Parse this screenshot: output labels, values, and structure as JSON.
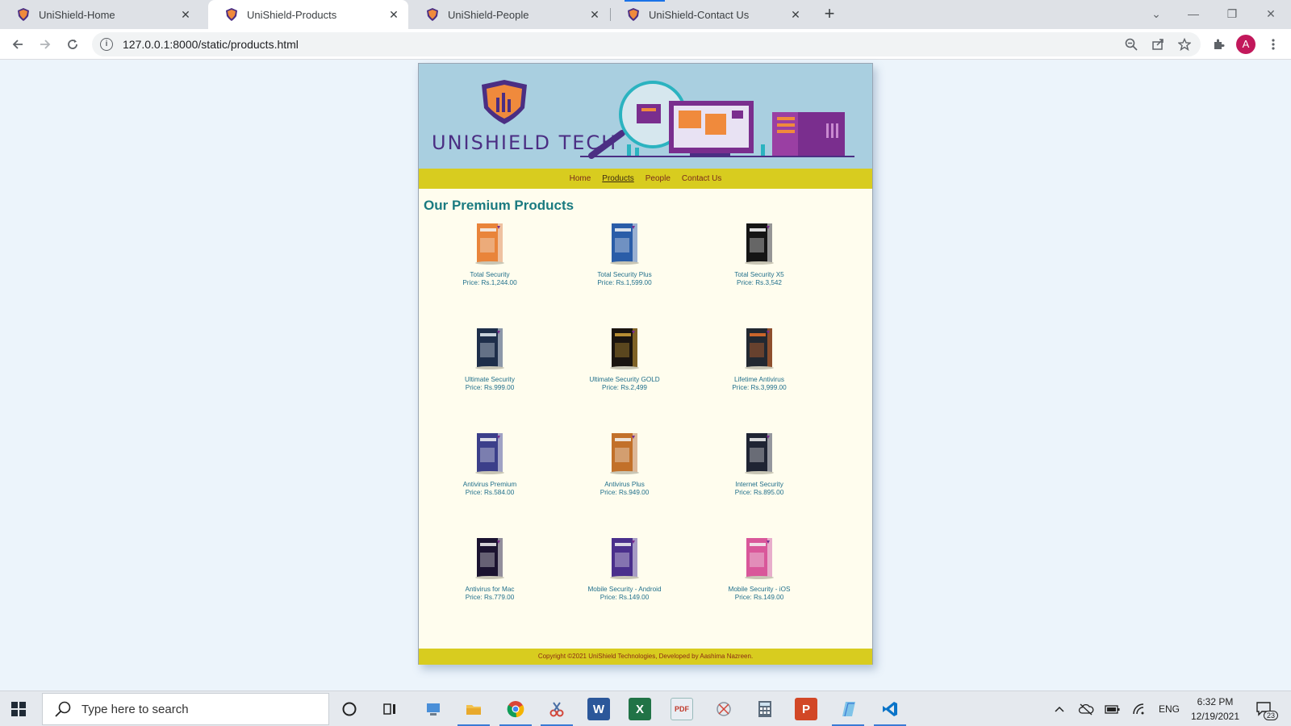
{
  "browser": {
    "tabs": [
      {
        "title": "UniShield-Home",
        "active": false
      },
      {
        "title": "UniShield-Products",
        "active": true
      },
      {
        "title": "UniShield-People",
        "active": false
      },
      {
        "title": "UniShield-Contact Us",
        "active": false
      }
    ],
    "new_tab_label": "+",
    "url": "127.0.0.1:8000/static/products.html",
    "profile_initial": "A"
  },
  "site": {
    "brand": "UNISHIELD TECH",
    "nav": [
      {
        "label": "Home",
        "current": false
      },
      {
        "label": "Products",
        "current": true
      },
      {
        "label": "People",
        "current": false
      },
      {
        "label": "Contact Us",
        "current": false
      }
    ],
    "heading": "Our Premium Products",
    "products": [
      {
        "name": "Total Security",
        "price": "Price: Rs.1,244.00",
        "box_color": "#e9843a",
        "accent": "#f4f4f4"
      },
      {
        "name": "Total Security Plus",
        "price": "Price: Rs.1,599.00",
        "box_color": "#2a5da8",
        "accent": "#f4f4f4"
      },
      {
        "name": "Total Security X5",
        "price": "Price: Rs.3,542",
        "box_color": "#151515",
        "accent": "#ffffff"
      },
      {
        "name": "Ultimate Security",
        "price": "Price: Rs.999.00",
        "box_color": "#1e2e4a",
        "accent": "#e8eef5"
      },
      {
        "name": "Ultimate Security GOLD",
        "price": "Price: Rs.2,499",
        "box_color": "#1a1410",
        "accent": "#d4a23a"
      },
      {
        "name": "Lifetime Antivirus",
        "price": "Price: Rs.3,999.00",
        "box_color": "#222831",
        "accent": "#e8702a"
      },
      {
        "name": "Antivirus Premium",
        "price": "Price: Rs.584.00",
        "box_color": "#3b3f8a",
        "accent": "#f4f4f4"
      },
      {
        "name": "Antivirus Plus",
        "price": "Price: Rs.949.00",
        "box_color": "#c2702a",
        "accent": "#f4f4f4"
      },
      {
        "name": "Internet Security",
        "price": "Price: Rs.895.00",
        "box_color": "#1f2433",
        "accent": "#f4f4f4"
      },
      {
        "name": "Antivirus for Mac",
        "price": "Price: Rs.779.00",
        "box_color": "#1b1330",
        "accent": "#f4f4f4"
      },
      {
        "name": "Mobile Security - Android",
        "price": "Price: Rs.149.00",
        "box_color": "#4a2f8c",
        "accent": "#f4f4f4"
      },
      {
        "name": "Mobile Security - iOS",
        "price": "Price: Rs.149.00",
        "box_color": "#d9579a",
        "accent": "#f4f4f4"
      }
    ],
    "footer": "Copyright ©2021 UniShield Technologies, Developed by Aashima Nazreen."
  },
  "taskbar": {
    "search_placeholder": "Type here to search",
    "language": "ENG",
    "time": "6:32 PM",
    "date": "12/19/2021",
    "notification_count": "23"
  },
  "colors": {
    "nav_bar": "#d8cc1f",
    "heading": "#1a7a80",
    "banner": "#a9cfe0",
    "page_bg": "#ecf4fb"
  }
}
